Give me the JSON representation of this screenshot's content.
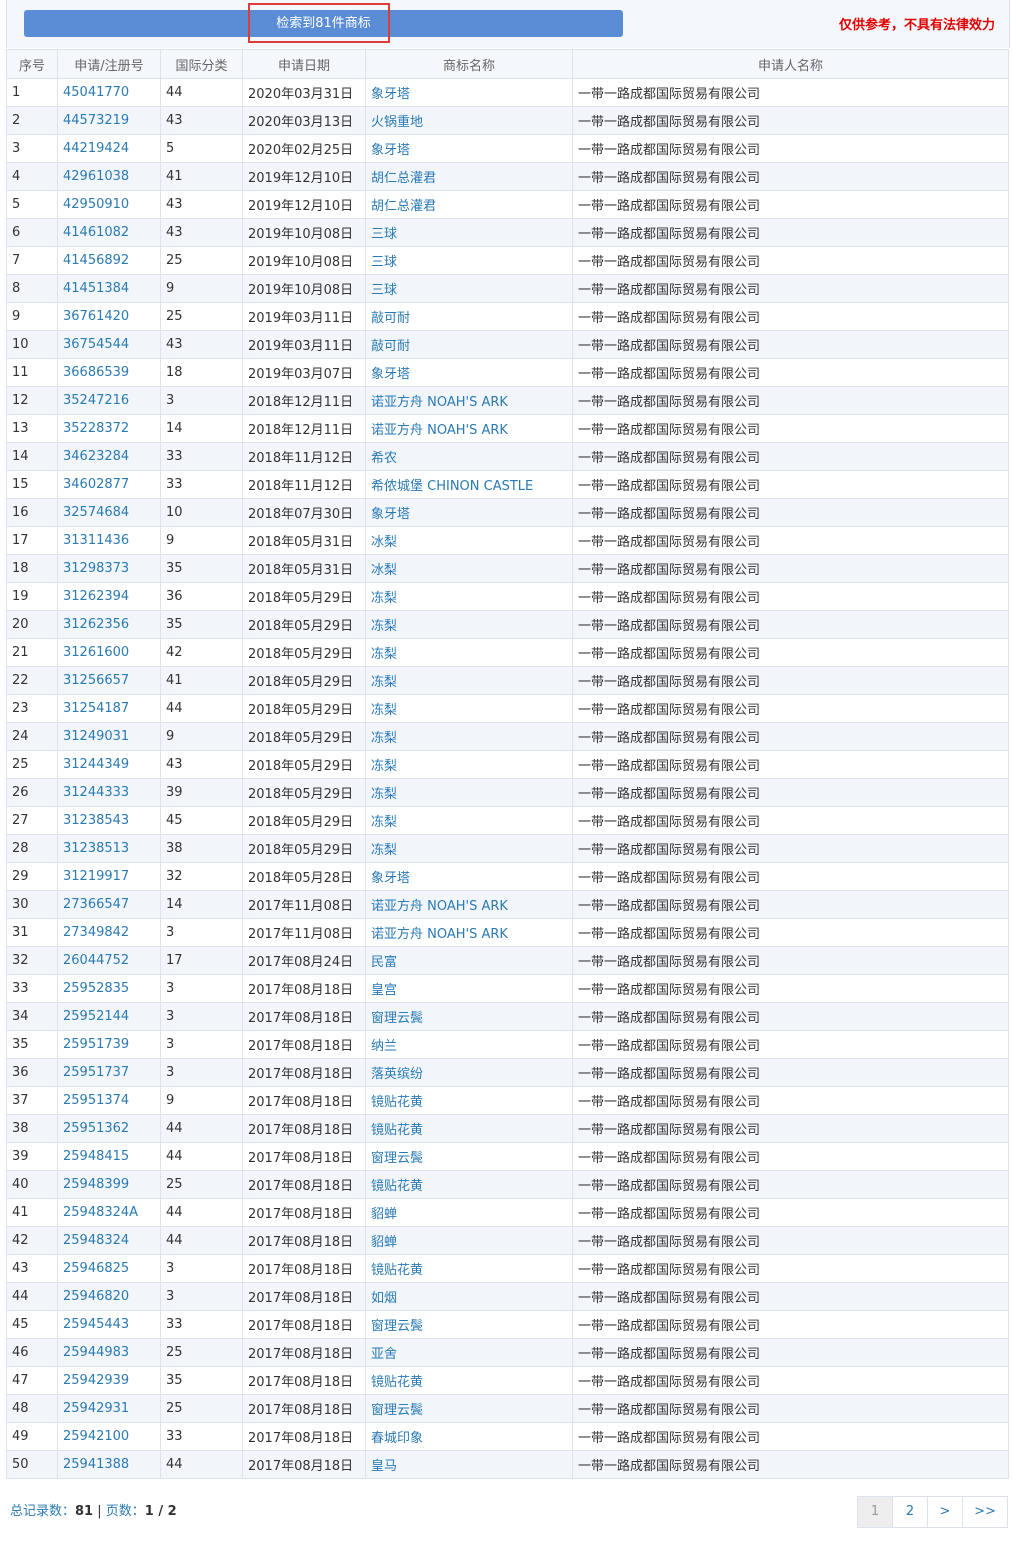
{
  "header": {
    "result_label": "检索到81件商标",
    "disclaimer": "仅供参考，不具有法律效力"
  },
  "table": {
    "columns": [
      "序号",
      "申请/注册号",
      "国际分类",
      "申请日期",
      "商标名称",
      "申请人名称"
    ],
    "rows": [
      [
        "1",
        "45041770",
        "44",
        "2020年03月31日",
        "象牙塔",
        "一带一路成都国际贸易有限公司"
      ],
      [
        "2",
        "44573219",
        "43",
        "2020年03月13日",
        "火锅重地",
        "一带一路成都国际贸易有限公司"
      ],
      [
        "3",
        "44219424",
        "5",
        "2020年02月25日",
        "象牙塔",
        "一带一路成都国际贸易有限公司"
      ],
      [
        "4",
        "42961038",
        "41",
        "2019年12月10日",
        "胡仁总灌君",
        "一带一路成都国际贸易有限公司"
      ],
      [
        "5",
        "42950910",
        "43",
        "2019年12月10日",
        "胡仁总灌君",
        "一带一路成都国际贸易有限公司"
      ],
      [
        "6",
        "41461082",
        "43",
        "2019年10月08日",
        "三球",
        "一带一路成都国际贸易有限公司"
      ],
      [
        "7",
        "41456892",
        "25",
        "2019年10月08日",
        "三球",
        "一带一路成都国际贸易有限公司"
      ],
      [
        "8",
        "41451384",
        "9",
        "2019年10月08日",
        "三球",
        "一带一路成都国际贸易有限公司"
      ],
      [
        "9",
        "36761420",
        "25",
        "2019年03月11日",
        "敲可耐",
        "一带一路成都国际贸易有限公司"
      ],
      [
        "10",
        "36754544",
        "43",
        "2019年03月11日",
        "敲可耐",
        "一带一路成都国际贸易有限公司"
      ],
      [
        "11",
        "36686539",
        "18",
        "2019年03月07日",
        "象牙塔",
        "一带一路成都国际贸易有限公司"
      ],
      [
        "12",
        "35247216",
        "3",
        "2018年12月11日",
        "诺亚方舟 NOAH'S ARK",
        "一带一路成都国际贸易有限公司"
      ],
      [
        "13",
        "35228372",
        "14",
        "2018年12月11日",
        "诺亚方舟 NOAH'S ARK",
        "一带一路成都国际贸易有限公司"
      ],
      [
        "14",
        "34623284",
        "33",
        "2018年11月12日",
        "希农",
        "一带一路成都国际贸易有限公司"
      ],
      [
        "15",
        "34602877",
        "33",
        "2018年11月12日",
        "希侬城堡 CHINON CASTLE",
        "一带一路成都国际贸易有限公司"
      ],
      [
        "16",
        "32574684",
        "10",
        "2018年07月30日",
        "象牙塔",
        "一带一路成都国际贸易有限公司"
      ],
      [
        "17",
        "31311436",
        "9",
        "2018年05月31日",
        "冰梨",
        "一带一路成都国际贸易有限公司"
      ],
      [
        "18",
        "31298373",
        "35",
        "2018年05月31日",
        "冰梨",
        "一带一路成都国际贸易有限公司"
      ],
      [
        "19",
        "31262394",
        "36",
        "2018年05月29日",
        "冻梨",
        "一带一路成都国际贸易有限公司"
      ],
      [
        "20",
        "31262356",
        "35",
        "2018年05月29日",
        "冻梨",
        "一带一路成都国际贸易有限公司"
      ],
      [
        "21",
        "31261600",
        "42",
        "2018年05月29日",
        "冻梨",
        "一带一路成都国际贸易有限公司"
      ],
      [
        "22",
        "31256657",
        "41",
        "2018年05月29日",
        "冻梨",
        "一带一路成都国际贸易有限公司"
      ],
      [
        "23",
        "31254187",
        "44",
        "2018年05月29日",
        "冻梨",
        "一带一路成都国际贸易有限公司"
      ],
      [
        "24",
        "31249031",
        "9",
        "2018年05月29日",
        "冻梨",
        "一带一路成都国际贸易有限公司"
      ],
      [
        "25",
        "31244349",
        "43",
        "2018年05月29日",
        "冻梨",
        "一带一路成都国际贸易有限公司"
      ],
      [
        "26",
        "31244333",
        "39",
        "2018年05月29日",
        "冻梨",
        "一带一路成都国际贸易有限公司"
      ],
      [
        "27",
        "31238543",
        "45",
        "2018年05月29日",
        "冻梨",
        "一带一路成都国际贸易有限公司"
      ],
      [
        "28",
        "31238513",
        "38",
        "2018年05月29日",
        "冻梨",
        "一带一路成都国际贸易有限公司"
      ],
      [
        "29",
        "31219917",
        "32",
        "2018年05月28日",
        "象牙塔",
        "一带一路成都国际贸易有限公司"
      ],
      [
        "30",
        "27366547",
        "14",
        "2017年11月08日",
        "诺亚方舟 NOAH'S ARK",
        "一带一路成都国际贸易有限公司"
      ],
      [
        "31",
        "27349842",
        "3",
        "2017年11月08日",
        "诺亚方舟 NOAH'S ARK",
        "一带一路成都国际贸易有限公司"
      ],
      [
        "32",
        "26044752",
        "17",
        "2017年08月24日",
        "民富",
        "一带一路成都国际贸易有限公司"
      ],
      [
        "33",
        "25952835",
        "3",
        "2017年08月18日",
        "皇宫",
        "一带一路成都国际贸易有限公司"
      ],
      [
        "34",
        "25952144",
        "3",
        "2017年08月18日",
        "窗理云鬓",
        "一带一路成都国际贸易有限公司"
      ],
      [
        "35",
        "25951739",
        "3",
        "2017年08月18日",
        "纳兰",
        "一带一路成都国际贸易有限公司"
      ],
      [
        "36",
        "25951737",
        "3",
        "2017年08月18日",
        "落英缤纷",
        "一带一路成都国际贸易有限公司"
      ],
      [
        "37",
        "25951374",
        "9",
        "2017年08月18日",
        "镜贴花黄",
        "一带一路成都国际贸易有限公司"
      ],
      [
        "38",
        "25951362",
        "44",
        "2017年08月18日",
        "镜贴花黄",
        "一带一路成都国际贸易有限公司"
      ],
      [
        "39",
        "25948415",
        "44",
        "2017年08月18日",
        "窗理云鬓",
        "一带一路成都国际贸易有限公司"
      ],
      [
        "40",
        "25948399",
        "25",
        "2017年08月18日",
        "镜贴花黄",
        "一带一路成都国际贸易有限公司"
      ],
      [
        "41",
        "25948324A",
        "44",
        "2017年08月18日",
        "貂蝉",
        "一带一路成都国际贸易有限公司"
      ],
      [
        "42",
        "25948324",
        "44",
        "2017年08月18日",
        "貂蝉",
        "一带一路成都国际贸易有限公司"
      ],
      [
        "43",
        "25946825",
        "3",
        "2017年08月18日",
        "镜贴花黄",
        "一带一路成都国际贸易有限公司"
      ],
      [
        "44",
        "25946820",
        "3",
        "2017年08月18日",
        "如烟",
        "一带一路成都国际贸易有限公司"
      ],
      [
        "45",
        "25945443",
        "33",
        "2017年08月18日",
        "窗理云鬓",
        "一带一路成都国际贸易有限公司"
      ],
      [
        "46",
        "25944983",
        "25",
        "2017年08月18日",
        "亚舍",
        "一带一路成都国际贸易有限公司"
      ],
      [
        "47",
        "25942939",
        "35",
        "2017年08月18日",
        "镜贴花黄",
        "一带一路成都国际贸易有限公司"
      ],
      [
        "48",
        "25942931",
        "25",
        "2017年08月18日",
        "窗理云鬓",
        "一带一路成都国际贸易有限公司"
      ],
      [
        "49",
        "25942100",
        "33",
        "2017年08月18日",
        "春城印象",
        "一带一路成都国际贸易有限公司"
      ],
      [
        "50",
        "25941388",
        "44",
        "2017年08月18日",
        "皇马",
        "一带一路成都国际贸易有限公司"
      ]
    ]
  },
  "footer": {
    "total_label": "总记录数：",
    "total_value": "81",
    "separator": "|",
    "pages_label": "页数：",
    "pages_value": "1 / 2"
  },
  "pagination": [
    {
      "label": "1",
      "active": true
    },
    {
      "label": "2",
      "active": false
    },
    {
      "label": ">",
      "active": false
    },
    {
      "label": ">>",
      "active": false
    }
  ],
  "colors": {
    "accent": "#5b8dd6",
    "link": "#2a7ab5",
    "disclaimer": "#e00000",
    "highlight": "#e03b3b"
  }
}
